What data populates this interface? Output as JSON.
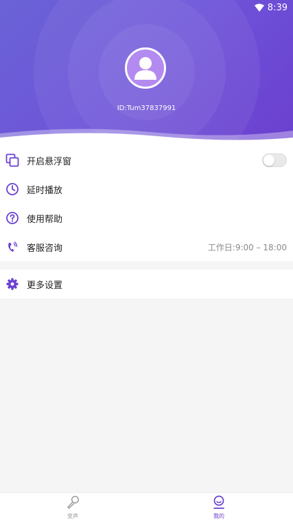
{
  "status_bar": {
    "time": "8:39",
    "wifi_icon": "wifi-icon"
  },
  "profile": {
    "avatar_icon": "user-avatar-icon",
    "user_id": "ID:Tum37837991"
  },
  "colors": {
    "accent": "#6a3fd0",
    "header_start": "#6a63d6",
    "header_end": "#6b3fcf",
    "background": "#f5f5f5"
  },
  "menu": {
    "items": [
      {
        "icon": "floating-window-icon",
        "label": "开启悬浮窗",
        "toggle_on": false
      },
      {
        "icon": "clock-icon",
        "label": "延时播放"
      },
      {
        "icon": "help-icon",
        "label": "使用帮助"
      },
      {
        "icon": "phone-icon",
        "label": "客服咨询",
        "detail": "工作日:9:00 – 18:00"
      }
    ],
    "settings": {
      "icon": "gear-icon",
      "label": "更多设置"
    }
  },
  "bottom_nav": {
    "items": [
      {
        "icon": "microphone-icon",
        "label": "变声",
        "active": false
      },
      {
        "icon": "profile-icon",
        "label": "我的",
        "active": true
      }
    ]
  }
}
